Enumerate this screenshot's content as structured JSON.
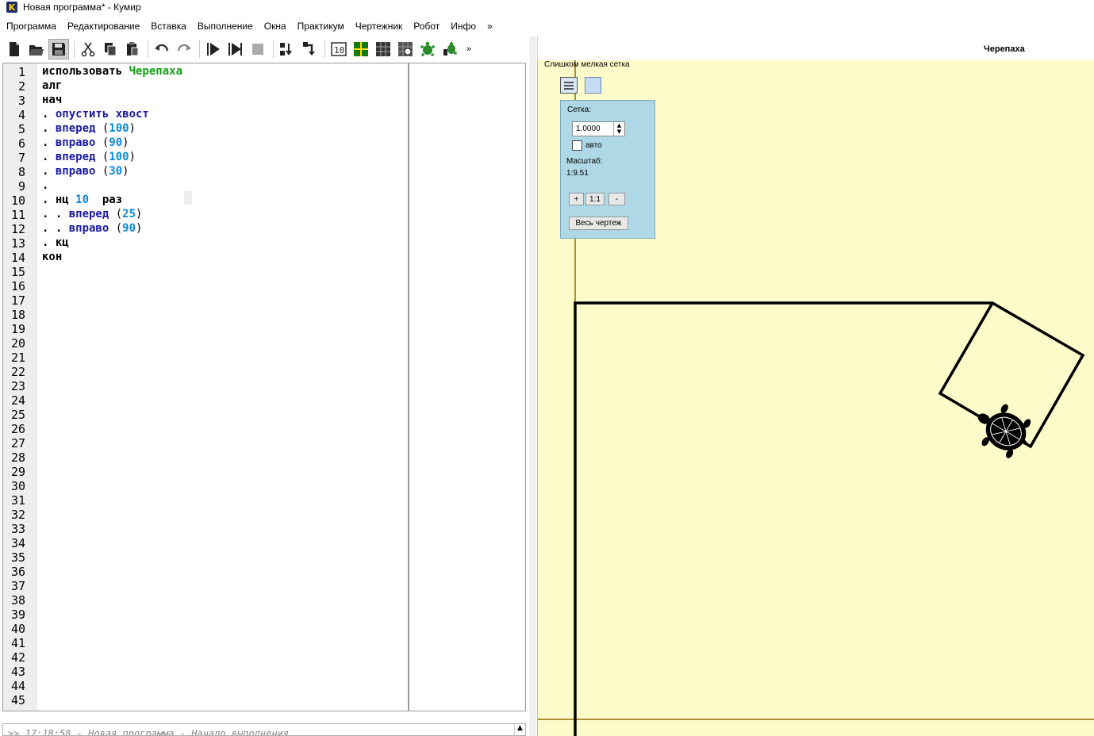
{
  "window": {
    "title": "Новая программа* - Кумир",
    "icon_letter": "K"
  },
  "menu": [
    "Программа",
    "Редактирование",
    "Вставка",
    "Выполнение",
    "Окна",
    "Практикум",
    "Чертежник",
    "Робот",
    "Инфо",
    "»"
  ],
  "toolbar": {
    "more": "»",
    "icons": [
      "new-file-icon",
      "open-folder-icon",
      "save-icon",
      "cut-icon",
      "copy-icon",
      "paste-icon",
      "undo-icon",
      "redo-icon",
      "run-icon",
      "step-run-icon",
      "stop-icon",
      "step-into-icon",
      "step-out-icon",
      "counter-icon",
      "grid-green-icon",
      "grid-black-icon",
      "robot-icon",
      "turtle-icon",
      "turtle-alt-icon"
    ]
  },
  "editor": {
    "line_count": 45,
    "lines": [
      [
        {
          "t": "использовать ",
          "c": "kw"
        },
        {
          "t": "Черепаха",
          "c": "mod"
        }
      ],
      [
        {
          "t": "алг",
          "c": "kw"
        }
      ],
      [
        {
          "t": "нач",
          "c": "kw"
        }
      ],
      [
        {
          "t": ". ",
          "c": "dot"
        },
        {
          "t": "опустить хвост",
          "c": "cmd"
        }
      ],
      [
        {
          "t": ". ",
          "c": "dot"
        },
        {
          "t": "вперед",
          "c": "cmd"
        },
        {
          "t": " (",
          "c": "paren"
        },
        {
          "t": "100",
          "c": "num"
        },
        {
          "t": ")",
          "c": "paren"
        }
      ],
      [
        {
          "t": ". ",
          "c": "dot"
        },
        {
          "t": "вправо",
          "c": "cmd"
        },
        {
          "t": " (",
          "c": "paren"
        },
        {
          "t": "90",
          "c": "num"
        },
        {
          "t": ")",
          "c": "paren"
        }
      ],
      [
        {
          "t": ". ",
          "c": "dot"
        },
        {
          "t": "вперед",
          "c": "cmd"
        },
        {
          "t": " (",
          "c": "paren"
        },
        {
          "t": "100",
          "c": "num"
        },
        {
          "t": ")",
          "c": "paren"
        }
      ],
      [
        {
          "t": ". ",
          "c": "dot"
        },
        {
          "t": "вправо",
          "c": "cmd"
        },
        {
          "t": " (",
          "c": "paren"
        },
        {
          "t": "30",
          "c": "num"
        },
        {
          "t": ")",
          "c": "paren"
        }
      ],
      [
        {
          "t": ".",
          "c": "dot"
        }
      ],
      [
        {
          "t": ". ",
          "c": "dot"
        },
        {
          "t": "нц ",
          "c": "kw"
        },
        {
          "t": "10",
          "c": "num"
        },
        {
          "t": "  раз",
          "c": "kw"
        }
      ],
      [
        {
          "t": ". . ",
          "c": "dot"
        },
        {
          "t": "вперед",
          "c": "cmd"
        },
        {
          "t": " (",
          "c": "paren"
        },
        {
          "t": "25",
          "c": "num"
        },
        {
          "t": ")",
          "c": "paren"
        }
      ],
      [
        {
          "t": ". . ",
          "c": "dot"
        },
        {
          "t": "вправо",
          "c": "cmd"
        },
        {
          "t": " (",
          "c": "paren"
        },
        {
          "t": "90",
          "c": "num"
        },
        {
          "t": ")",
          "c": "paren"
        }
      ],
      [
        {
          "t": ". ",
          "c": "dot"
        },
        {
          "t": "кц",
          "c": "kw"
        }
      ],
      [
        {
          "t": "кон",
          "c": "kw"
        }
      ]
    ]
  },
  "console": {
    "text": ">> 17:18:58 - Новая программа - Начало выполнения",
    "scroll_up": "▲"
  },
  "turtle": {
    "title": "Черепаха",
    "grid_warning": "Слишком мелкая сетка",
    "grid_label": "Сетка:",
    "grid_value": "1.0000",
    "auto_label": "авто",
    "auto_checked": false,
    "scale_label": "Масштаб:",
    "scale_value": "1:9.51",
    "zoom_in": "+",
    "zoom_reset": "1:1",
    "zoom_out": "-",
    "fit_all": "Весь чертеж",
    "canvas_color": "#fdfbc9",
    "axis_color": "#9a6b00"
  },
  "colors": {
    "keyword": "#000000",
    "command": "#1a1aa6",
    "number": "#0a8ad8",
    "module": "#0ea012"
  }
}
